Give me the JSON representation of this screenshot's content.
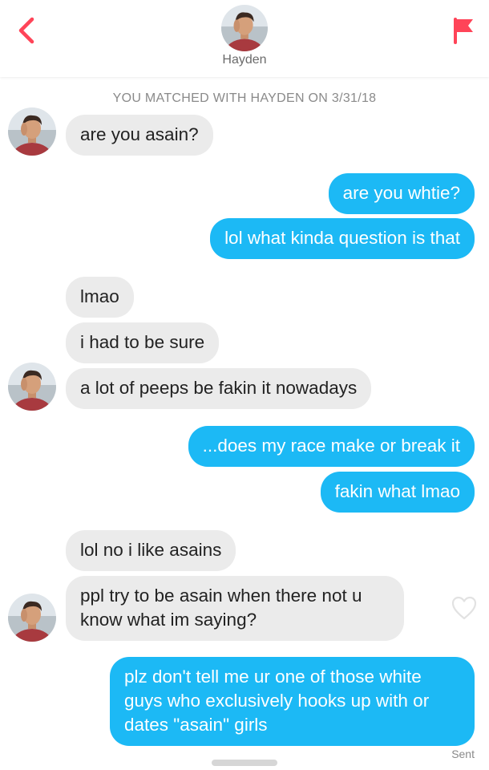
{
  "header": {
    "name": "Hayden",
    "icons": {
      "back": "chevron-left-icon",
      "flag": "report-flag-icon",
      "avatar": "profile-photo"
    }
  },
  "match_banner": "YOU MATCHED WITH HAYDEN ON 3/31/18",
  "messages": [
    {
      "from": "them",
      "text": "are you asain?"
    },
    {
      "from": "me",
      "text": "are you whtie?"
    },
    {
      "from": "me",
      "text": "lol what kinda question is that"
    },
    {
      "from": "them",
      "text": "lmao"
    },
    {
      "from": "them",
      "text": "i had to be sure"
    },
    {
      "from": "them",
      "text": "a lot of peeps be fakin it nowadays"
    },
    {
      "from": "me",
      "text": "...does my race make or break it"
    },
    {
      "from": "me",
      "text": "fakin what lmao"
    },
    {
      "from": "them",
      "text": "lol no i like asains"
    },
    {
      "from": "them",
      "text": "ppl try to be asain when there not u know what im saying?"
    },
    {
      "from": "me",
      "text": "plz don't tell me ur one of those white guys who exclusively hooks up with or dates \"asain\" girls"
    }
  ],
  "status": "Sent",
  "colors": {
    "outgoing": "#1cb9f5",
    "incoming": "#ebebeb",
    "flag": "#ff4458",
    "back": "#ff4458"
  }
}
